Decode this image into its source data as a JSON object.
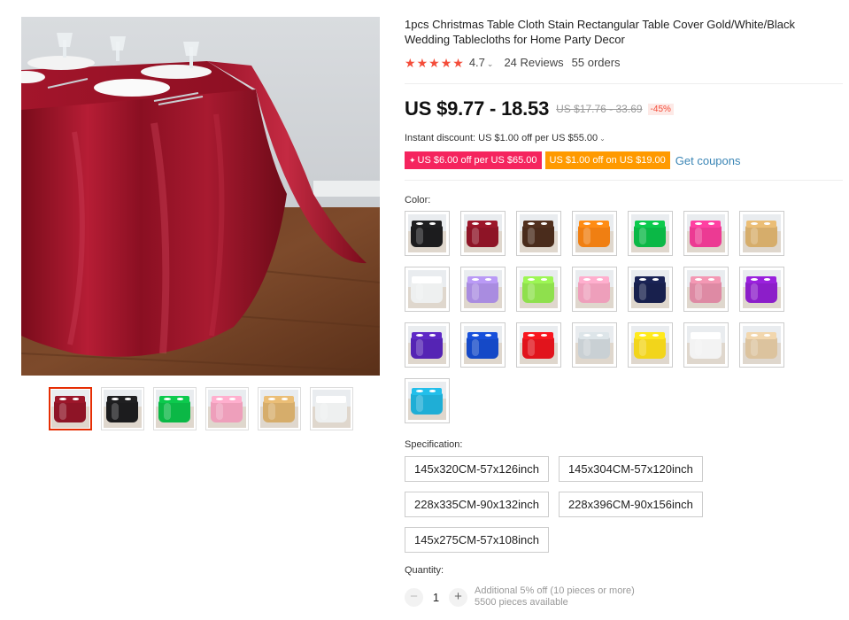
{
  "product": {
    "title": "1pcs Christmas Table Cloth Stain Rectangular Table Cover Gold/White/Black Wedding Tablecloths for Home Party Decor",
    "rating_stars": 5,
    "rating": "4.7",
    "rating_chevron": "⌄",
    "reviews": "24 Reviews",
    "orders": "55 orders"
  },
  "price": {
    "current": "US $9.77 - 18.53",
    "original": "US $17.76 - 33.69",
    "discount": "-45%"
  },
  "instant_discount": {
    "text": "Instant discount: US $1.00 off per US $55.00",
    "chevron": "⌄"
  },
  "coupons": {
    "items": [
      {
        "icon": "spark-icon",
        "label": "US $6.00 off per US $65.00",
        "color": "#f5245e"
      },
      {
        "label": "US $1.00 off on US $19.00",
        "color": "#ff9a00"
      }
    ],
    "get_label": "Get coupons"
  },
  "color": {
    "label": "Color:",
    "options": [
      {
        "name": "black",
        "hex": "#1c1c1e"
      },
      {
        "name": "burgundy",
        "hex": "#8e1426"
      },
      {
        "name": "coffee",
        "hex": "#4a2c1c"
      },
      {
        "name": "orange",
        "hex": "#f07f12"
      },
      {
        "name": "green",
        "hex": "#0bb846"
      },
      {
        "name": "rose",
        "hex": "#ec3a93"
      },
      {
        "name": "champagne",
        "hex": "#d6ad6b"
      },
      {
        "name": "white",
        "hex": "#eef0f0"
      },
      {
        "name": "lavender",
        "hex": "#a98ce0"
      },
      {
        "name": "lime",
        "hex": "#8fe04d"
      },
      {
        "name": "pink",
        "hex": "#ee9fbb"
      },
      {
        "name": "navy",
        "hex": "#18204d"
      },
      {
        "name": "dusty-pink",
        "hex": "#de8aa4"
      },
      {
        "name": "purple",
        "hex": "#8c1ec9"
      },
      {
        "name": "violet",
        "hex": "#5524b4"
      },
      {
        "name": "royal-blue",
        "hex": "#1549c7"
      },
      {
        "name": "red",
        "hex": "#e1141c"
      },
      {
        "name": "silver",
        "hex": "#c9d0d4"
      },
      {
        "name": "yellow",
        "hex": "#f2d51b"
      },
      {
        "name": "ivory",
        "hex": "#f3f3f3"
      },
      {
        "name": "beige",
        "hex": "#dcc39e"
      },
      {
        "name": "turquoise",
        "hex": "#1faed6"
      }
    ]
  },
  "thumbnails": [
    {
      "name": "burgundy",
      "hex": "#8e1426"
    },
    {
      "name": "black",
      "hex": "#1c1c1e"
    },
    {
      "name": "green",
      "hex": "#0bb846"
    },
    {
      "name": "pink",
      "hex": "#ee9fbb"
    },
    {
      "name": "champagne",
      "hex": "#d6ad6b"
    },
    {
      "name": "white",
      "hex": "#eef0f0"
    }
  ],
  "specification": {
    "label": "Specification:",
    "options": [
      "145x320CM-57x126inch",
      "145x304CM-57x120inch",
      "228x335CM-90x132inch",
      "228x396CM-90x156inch",
      "145x275CM-57x108inch"
    ]
  },
  "quantity": {
    "label": "Quantity:",
    "minus": "−",
    "plus": "+",
    "value": "1",
    "extra_discount": "Additional 5% off (10 pieces or more)",
    "available": "5500 pieces available"
  }
}
